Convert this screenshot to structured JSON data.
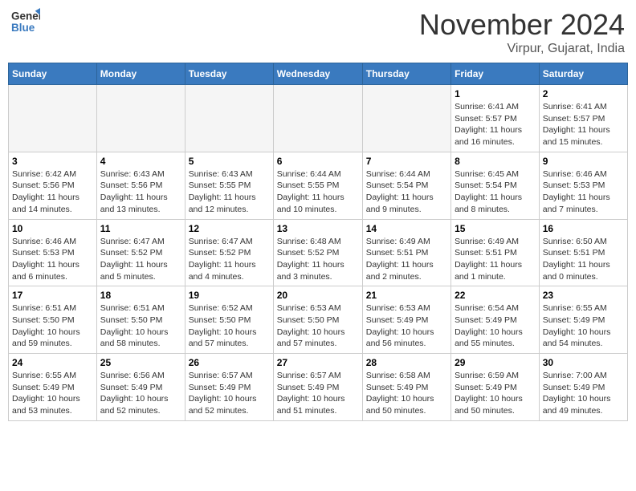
{
  "header": {
    "logo_general": "General",
    "logo_blue": "Blue",
    "month_title": "November 2024",
    "location": "Virpur, Gujarat, India"
  },
  "days_of_week": [
    "Sunday",
    "Monday",
    "Tuesday",
    "Wednesday",
    "Thursday",
    "Friday",
    "Saturday"
  ],
  "weeks": [
    [
      {
        "day": "",
        "info": ""
      },
      {
        "day": "",
        "info": ""
      },
      {
        "day": "",
        "info": ""
      },
      {
        "day": "",
        "info": ""
      },
      {
        "day": "",
        "info": ""
      },
      {
        "day": "1",
        "info": "Sunrise: 6:41 AM\nSunset: 5:57 PM\nDaylight: 11 hours and 16 minutes."
      },
      {
        "day": "2",
        "info": "Sunrise: 6:41 AM\nSunset: 5:57 PM\nDaylight: 11 hours and 15 minutes."
      }
    ],
    [
      {
        "day": "3",
        "info": "Sunrise: 6:42 AM\nSunset: 5:56 PM\nDaylight: 11 hours and 14 minutes."
      },
      {
        "day": "4",
        "info": "Sunrise: 6:43 AM\nSunset: 5:56 PM\nDaylight: 11 hours and 13 minutes."
      },
      {
        "day": "5",
        "info": "Sunrise: 6:43 AM\nSunset: 5:55 PM\nDaylight: 11 hours and 12 minutes."
      },
      {
        "day": "6",
        "info": "Sunrise: 6:44 AM\nSunset: 5:55 PM\nDaylight: 11 hours and 10 minutes."
      },
      {
        "day": "7",
        "info": "Sunrise: 6:44 AM\nSunset: 5:54 PM\nDaylight: 11 hours and 9 minutes."
      },
      {
        "day": "8",
        "info": "Sunrise: 6:45 AM\nSunset: 5:54 PM\nDaylight: 11 hours and 8 minutes."
      },
      {
        "day": "9",
        "info": "Sunrise: 6:46 AM\nSunset: 5:53 PM\nDaylight: 11 hours and 7 minutes."
      }
    ],
    [
      {
        "day": "10",
        "info": "Sunrise: 6:46 AM\nSunset: 5:53 PM\nDaylight: 11 hours and 6 minutes."
      },
      {
        "day": "11",
        "info": "Sunrise: 6:47 AM\nSunset: 5:52 PM\nDaylight: 11 hours and 5 minutes."
      },
      {
        "day": "12",
        "info": "Sunrise: 6:47 AM\nSunset: 5:52 PM\nDaylight: 11 hours and 4 minutes."
      },
      {
        "day": "13",
        "info": "Sunrise: 6:48 AM\nSunset: 5:52 PM\nDaylight: 11 hours and 3 minutes."
      },
      {
        "day": "14",
        "info": "Sunrise: 6:49 AM\nSunset: 5:51 PM\nDaylight: 11 hours and 2 minutes."
      },
      {
        "day": "15",
        "info": "Sunrise: 6:49 AM\nSunset: 5:51 PM\nDaylight: 11 hours and 1 minute."
      },
      {
        "day": "16",
        "info": "Sunrise: 6:50 AM\nSunset: 5:51 PM\nDaylight: 11 hours and 0 minutes."
      }
    ],
    [
      {
        "day": "17",
        "info": "Sunrise: 6:51 AM\nSunset: 5:50 PM\nDaylight: 10 hours and 59 minutes."
      },
      {
        "day": "18",
        "info": "Sunrise: 6:51 AM\nSunset: 5:50 PM\nDaylight: 10 hours and 58 minutes."
      },
      {
        "day": "19",
        "info": "Sunrise: 6:52 AM\nSunset: 5:50 PM\nDaylight: 10 hours and 57 minutes."
      },
      {
        "day": "20",
        "info": "Sunrise: 6:53 AM\nSunset: 5:50 PM\nDaylight: 10 hours and 57 minutes."
      },
      {
        "day": "21",
        "info": "Sunrise: 6:53 AM\nSunset: 5:49 PM\nDaylight: 10 hours and 56 minutes."
      },
      {
        "day": "22",
        "info": "Sunrise: 6:54 AM\nSunset: 5:49 PM\nDaylight: 10 hours and 55 minutes."
      },
      {
        "day": "23",
        "info": "Sunrise: 6:55 AM\nSunset: 5:49 PM\nDaylight: 10 hours and 54 minutes."
      }
    ],
    [
      {
        "day": "24",
        "info": "Sunrise: 6:55 AM\nSunset: 5:49 PM\nDaylight: 10 hours and 53 minutes."
      },
      {
        "day": "25",
        "info": "Sunrise: 6:56 AM\nSunset: 5:49 PM\nDaylight: 10 hours and 52 minutes."
      },
      {
        "day": "26",
        "info": "Sunrise: 6:57 AM\nSunset: 5:49 PM\nDaylight: 10 hours and 52 minutes."
      },
      {
        "day": "27",
        "info": "Sunrise: 6:57 AM\nSunset: 5:49 PM\nDaylight: 10 hours and 51 minutes."
      },
      {
        "day": "28",
        "info": "Sunrise: 6:58 AM\nSunset: 5:49 PM\nDaylight: 10 hours and 50 minutes."
      },
      {
        "day": "29",
        "info": "Sunrise: 6:59 AM\nSunset: 5:49 PM\nDaylight: 10 hours and 50 minutes."
      },
      {
        "day": "30",
        "info": "Sunrise: 7:00 AM\nSunset: 5:49 PM\nDaylight: 10 hours and 49 minutes."
      }
    ]
  ]
}
